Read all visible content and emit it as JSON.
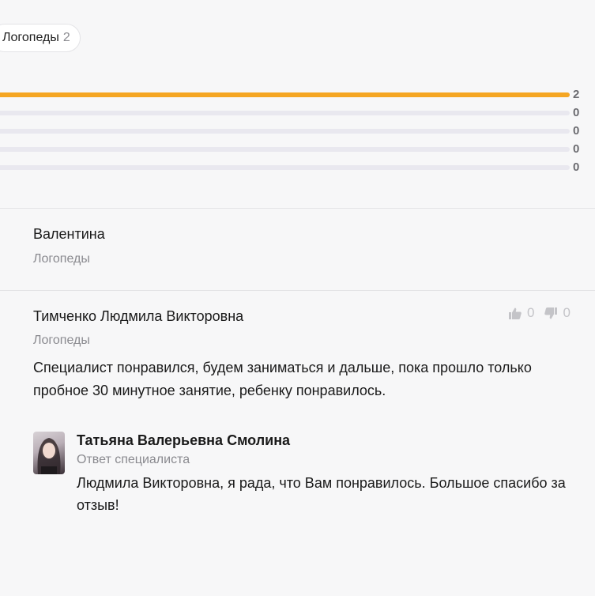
{
  "filter_chip": {
    "label": "Логопеды",
    "count": "2"
  },
  "rating_distribution": {
    "rows": [
      {
        "count": "2",
        "fill_fraction": 1.0,
        "color": "#f5a623"
      },
      {
        "count": "0",
        "fill_fraction": 0
      },
      {
        "count": "0",
        "fill_fraction": 0
      },
      {
        "count": "0",
        "fill_fraction": 0
      },
      {
        "count": "0",
        "fill_fraction": 0
      }
    ]
  },
  "reviews": [
    {
      "author": "Валентина",
      "category": "Логопеды"
    },
    {
      "author": "Тимченко Людмила Викторовна",
      "category": "Логопеды",
      "likes": "0",
      "dislikes": "0",
      "text": "Специалист понравился, будем заниматься и дальше, пока прошло только пробное 30 минутное занятие, ребенку понравилось.",
      "reply": {
        "author": "Татьяна Валерьевна Смолина",
        "role": "Ответ специалиста",
        "text": "Людмила Викторовна, я рада, что Вам понравилось. Большое спасибо за отзыв!"
      }
    }
  ],
  "icons": {
    "like": "thumbs-up-icon",
    "dislike": "thumbs-down-icon"
  }
}
